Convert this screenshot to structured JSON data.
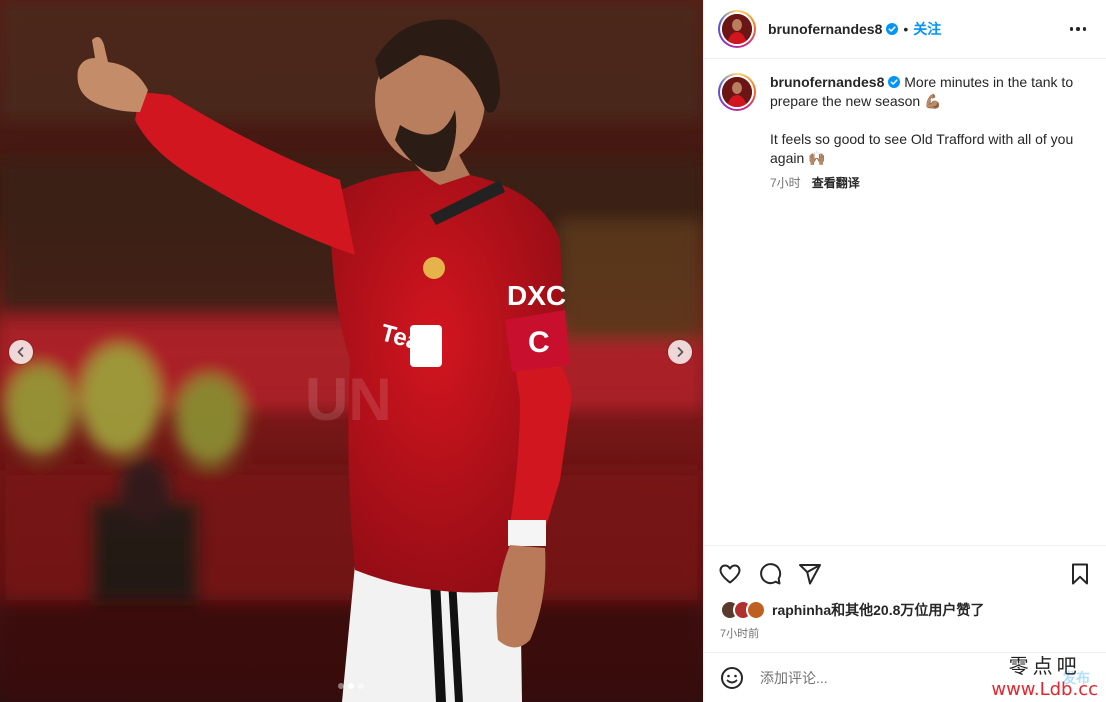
{
  "post": {
    "username": "brunofernandes8",
    "follow_label": "关注",
    "separator": "•",
    "caption_line1": "More minutes in the tank to prepare the new season 💪🏽",
    "caption_line2": "It feels so good to see Old Trafford with all of you again 🙌🏽",
    "caption_time": "7小时",
    "translate_label": "查看翻译",
    "likes_text": "raphinha和其他20.8万位用户赞了",
    "time_ago": "7小时前",
    "comment_placeholder": "添加评论...",
    "post_label": "发布"
  },
  "media": {
    "dots_total": 3,
    "active_dot": 2
  },
  "watermark": {
    "text_cn": "零点吧",
    "url": "www.Ldb.cc"
  },
  "colors": {
    "accent": "#0095f6",
    "verified": "#0095f6",
    "kit_red": "#c8102e"
  },
  "icons": [
    "chevron-left-icon",
    "chevron-right-icon",
    "heart-icon",
    "comment-icon",
    "share-icon",
    "bookmark-icon",
    "emoji-icon",
    "more-icon",
    "verified-icon"
  ]
}
